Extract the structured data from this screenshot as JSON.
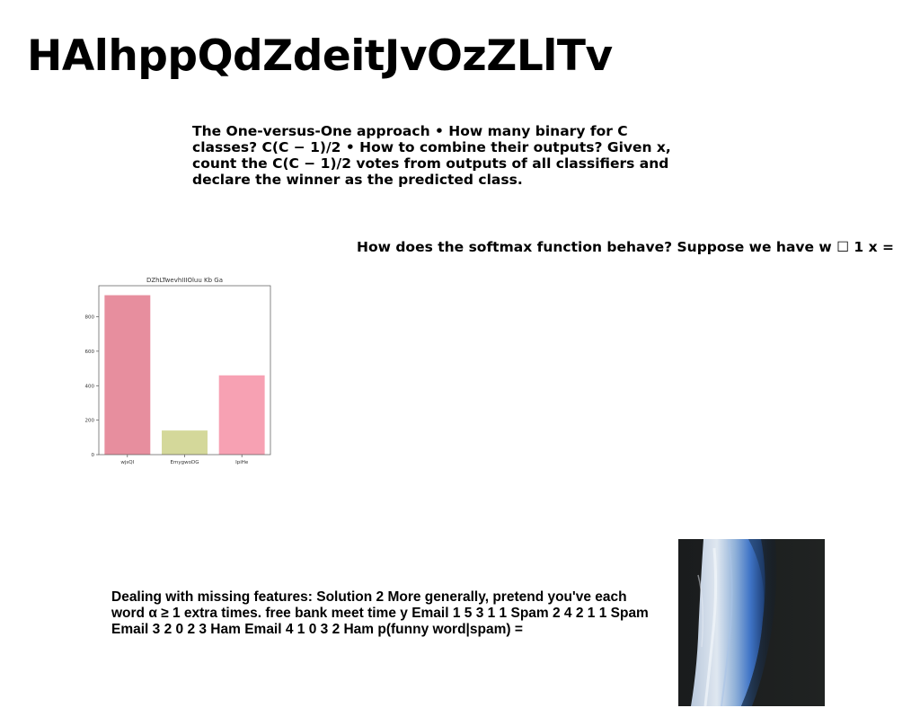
{
  "document": {
    "title": "HAlhppQdZdeitJvOzZLlTv",
    "paragraphs": {
      "one_vs_one": "The One-versus-One approach • How many binary for C classes? C(C − 1)/2 • How to combine their outputs? Given x, count the C(C − 1)/2 votes from outputs of all classifiers and declare the winner as the predicted class.",
      "softmax": "How does the softmax function behave? Suppose we have w ☐ 1 x =",
      "missing_features": "Dealing with missing features: Solution 2 More generally, pretend you've each word α ≥ 1 extra times. free bank meet time y Email 1 5 3 1 1 Spam 2 4 2 1 1 Spam Email 3 2 0 2 3 Ham Email 4 1 0 3 2 Ham p(funny word|spam) ="
    }
  },
  "chart_data": {
    "type": "bar",
    "title": "DZhLTwevhIIIOluu Kb Ga",
    "categories": [
      "wjsQI",
      "EmygwoDG",
      "IpiHe"
    ],
    "values": [
      925,
      140,
      460
    ],
    "colors": [
      "#e78e9e",
      "#d4d89a",
      "#f7a1b3"
    ],
    "xlabel": "",
    "ylabel": "",
    "ylim": [
      0,
      980
    ],
    "yticks": [
      0,
      200,
      400,
      600,
      800
    ],
    "grid": false
  }
}
